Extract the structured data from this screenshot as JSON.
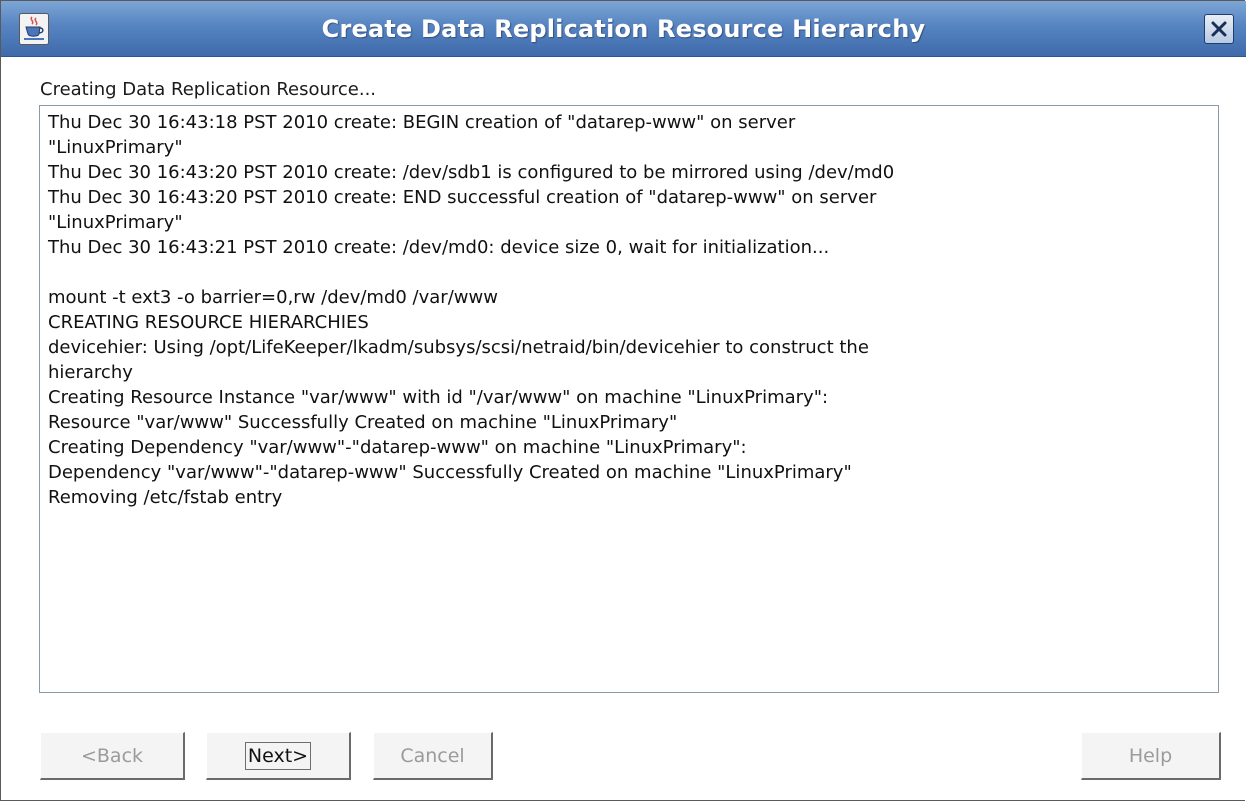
{
  "window": {
    "title": "Create Data Replication Resource Hierarchy",
    "app_icon": "java-coffee-cup-icon",
    "close_icon": "close-x-icon"
  },
  "status_label": "Creating Data Replication Resource...",
  "log_lines": [
    "Thu Dec 30 16:43:18 PST 2010 create: BEGIN creation of \"datarep-www\" on server",
    "\"LinuxPrimary\"",
    "Thu Dec 30 16:43:20 PST 2010 create: /dev/sdb1 is configured to be mirrored using /dev/md0",
    "Thu Dec 30 16:43:20 PST 2010 create: END successful creation of \"datarep-www\" on server",
    "\"LinuxPrimary\"",
    "Thu Dec 30 16:43:21 PST 2010 create: /dev/md0: device size 0, wait for initialization...",
    "",
    "mount -t ext3 -o barrier=0,rw /dev/md0 /var/www",
    "CREATING RESOURCE HIERARCHIES",
    "devicehier: Using /opt/LifeKeeper/lkadm/subsys/scsi/netraid/bin/devicehier to construct the",
    "hierarchy",
    "Creating Resource Instance \"var/www\" with id \"/var/www\" on machine \"LinuxPrimary\":",
    "Resource \"var/www\" Successfully Created on machine \"LinuxPrimary\"",
    "Creating Dependency \"var/www\"-\"datarep-www\" on machine \"LinuxPrimary\":",
    "Dependency \"var/www\"-\"datarep-www\" Successfully Created on machine \"LinuxPrimary\"",
    "Removing /etc/fstab entry"
  ],
  "buttons": {
    "back": "<Back",
    "next": "Next>",
    "cancel": "Cancel",
    "help": "Help"
  }
}
